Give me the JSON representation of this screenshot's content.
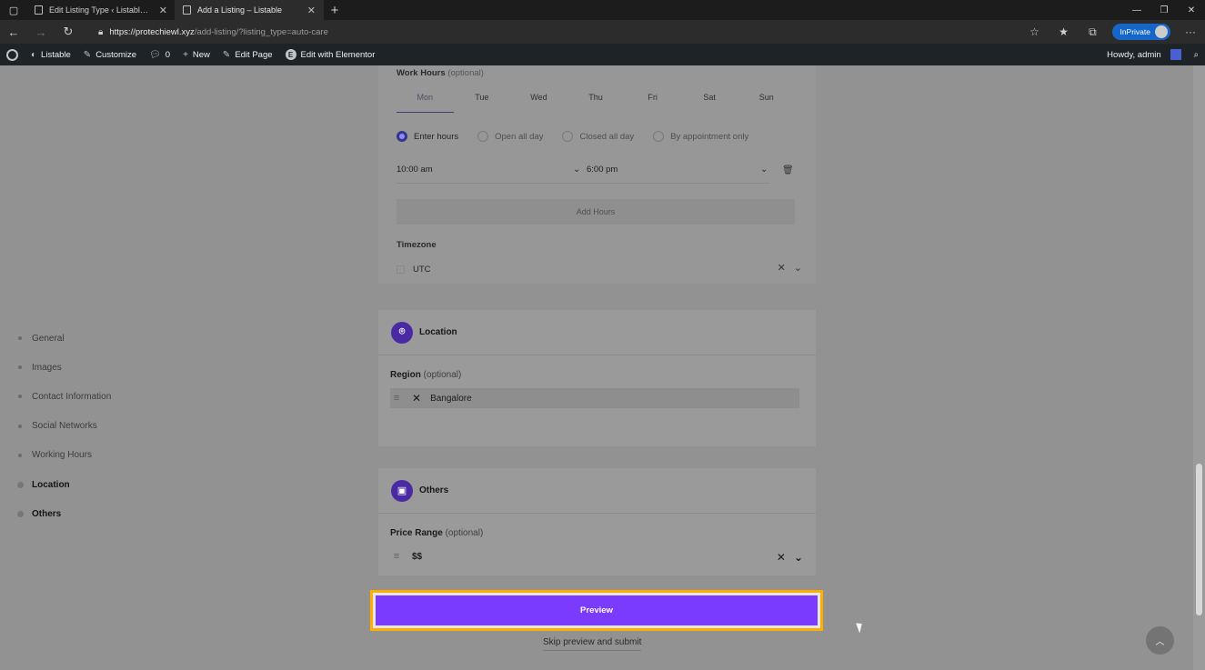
{
  "browser": {
    "tabs": [
      {
        "title": "Edit Listing Type ‹ Listable — W..."
      },
      {
        "title": "Add a Listing – Listable"
      }
    ],
    "url_host": "https://protechiewl.xyz",
    "url_path": "/add-listing/?listing_type=auto-care",
    "inprivate": "InPrivate"
  },
  "wpbar": {
    "site": "Listable",
    "customize": "Customize",
    "comments": "0",
    "new": "New",
    "edit_page": "Edit Page",
    "elementor": "Edit with Elementor",
    "howdy": "Howdy, admin"
  },
  "sidenav": [
    "General",
    "Images",
    "Contact Information",
    "Social Networks",
    "Working Hours",
    "Location",
    "Others"
  ],
  "work_hours": {
    "label": "Work Hours",
    "optional": "(optional)",
    "days": [
      "Mon",
      "Tue",
      "Wed",
      "Thu",
      "Fri",
      "Sat",
      "Sun"
    ],
    "active_day": "Mon",
    "options": [
      "Enter hours",
      "Open all day",
      "Closed all day",
      "By appointment only"
    ],
    "selected_option": "Enter hours",
    "open_time": "10:00 am",
    "close_time": "6:00 pm",
    "add_hours": "Add Hours",
    "timezone_label": "Timezone",
    "timezone": "UTC"
  },
  "location": {
    "title": "Location",
    "region_label": "Region",
    "optional": "(optional)",
    "region_value": "Bangalore"
  },
  "others": {
    "title": "Others",
    "price_label": "Price Range",
    "optional": "(optional)",
    "price_value": "$$"
  },
  "actions": {
    "preview": "Preview",
    "skip": "Skip preview and submit"
  },
  "colors": {
    "accent": "#7a3bff",
    "highlight": "#ffae00"
  }
}
